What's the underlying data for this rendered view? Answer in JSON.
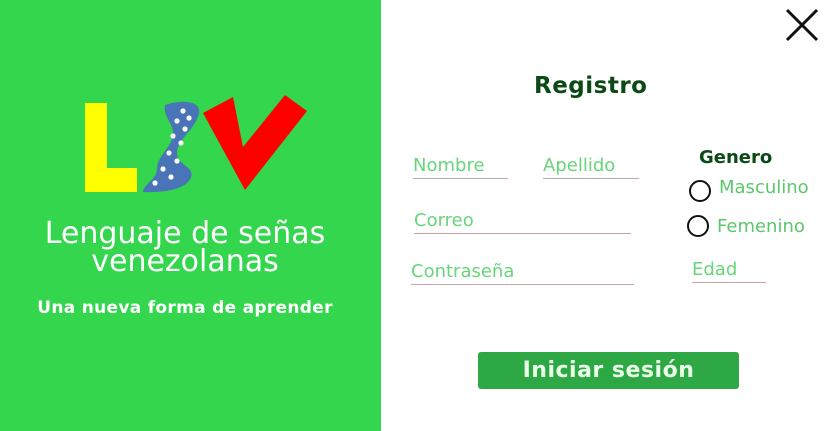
{
  "colors": {
    "panel_green": "#33d64d",
    "button_green": "#2ea845",
    "title_dark_green": "#0b4a16",
    "field_text_green": "#5ac86b",
    "logo_yellow": "#ffff00",
    "logo_blue": "#4a74b8",
    "logo_red": "#ff0000"
  },
  "left_panel": {
    "logo_alt": "LSV",
    "tagline_line1": "Lenguaje de señas",
    "tagline_line2": "venezolanas",
    "subtitle": "Una nueva forma de aprender"
  },
  "form": {
    "title": "Registro",
    "fields": {
      "nombre_placeholder": "Nombre",
      "apellido_placeholder": "Apellido",
      "correo_placeholder": "Correo",
      "contrasena_placeholder": "Contraseña",
      "edad_placeholder": "Edad"
    },
    "gender": {
      "title": "Genero",
      "options": [
        "Masculino",
        "Femenino"
      ]
    },
    "submit_label": "Iniciar sesión"
  },
  "icons": {
    "close": "close-icon"
  }
}
